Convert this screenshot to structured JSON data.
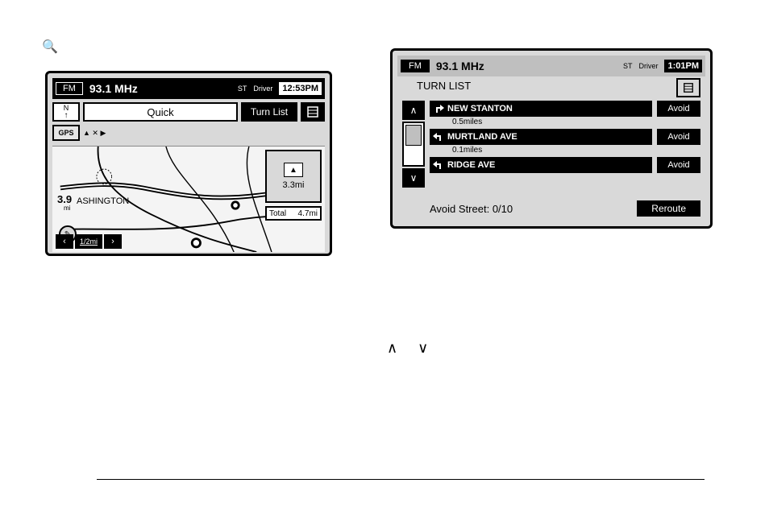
{
  "status": {
    "band": "FM",
    "frequency": "93.1 MHz",
    "stereo": "ST",
    "driver": "Driver"
  },
  "left": {
    "clock": "12:53PM",
    "compass_dir": "N",
    "compass_arrow": "↑",
    "quick_label": "Quick",
    "turn_list_label": "Turn List",
    "gps_label": "GPS",
    "ahead_dist": "3.9",
    "ahead_unit": "mi",
    "city": "ASHINGTON",
    "zoom_prev": "‹",
    "zoom_next": "›",
    "zoom_scale": "1/2mi",
    "highway_icon": "▲",
    "next_turn_dist": "3.3mi",
    "total_label": "Total",
    "total_dist": "4.7mi"
  },
  "right": {
    "clock": "1:01PM",
    "title": "TURN LIST",
    "scroll_up": "∧",
    "scroll_down": "∨",
    "turns": [
      {
        "name": "NEW STANTON",
        "dist": "0.5miles",
        "avoid": "Avoid",
        "dir": "right"
      },
      {
        "name": "MURTLAND AVE",
        "dist": "0.1miles",
        "avoid": "Avoid",
        "dir": "left"
      },
      {
        "name": "RIDGE AVE",
        "dist": "",
        "avoid": "Avoid",
        "dir": "left"
      }
    ],
    "avoid_street_label": "Avoid Street:",
    "avoid_street_value": "0/10",
    "reroute_label": "Reroute"
  },
  "page": {
    "chevrons": "∧  ∨"
  }
}
